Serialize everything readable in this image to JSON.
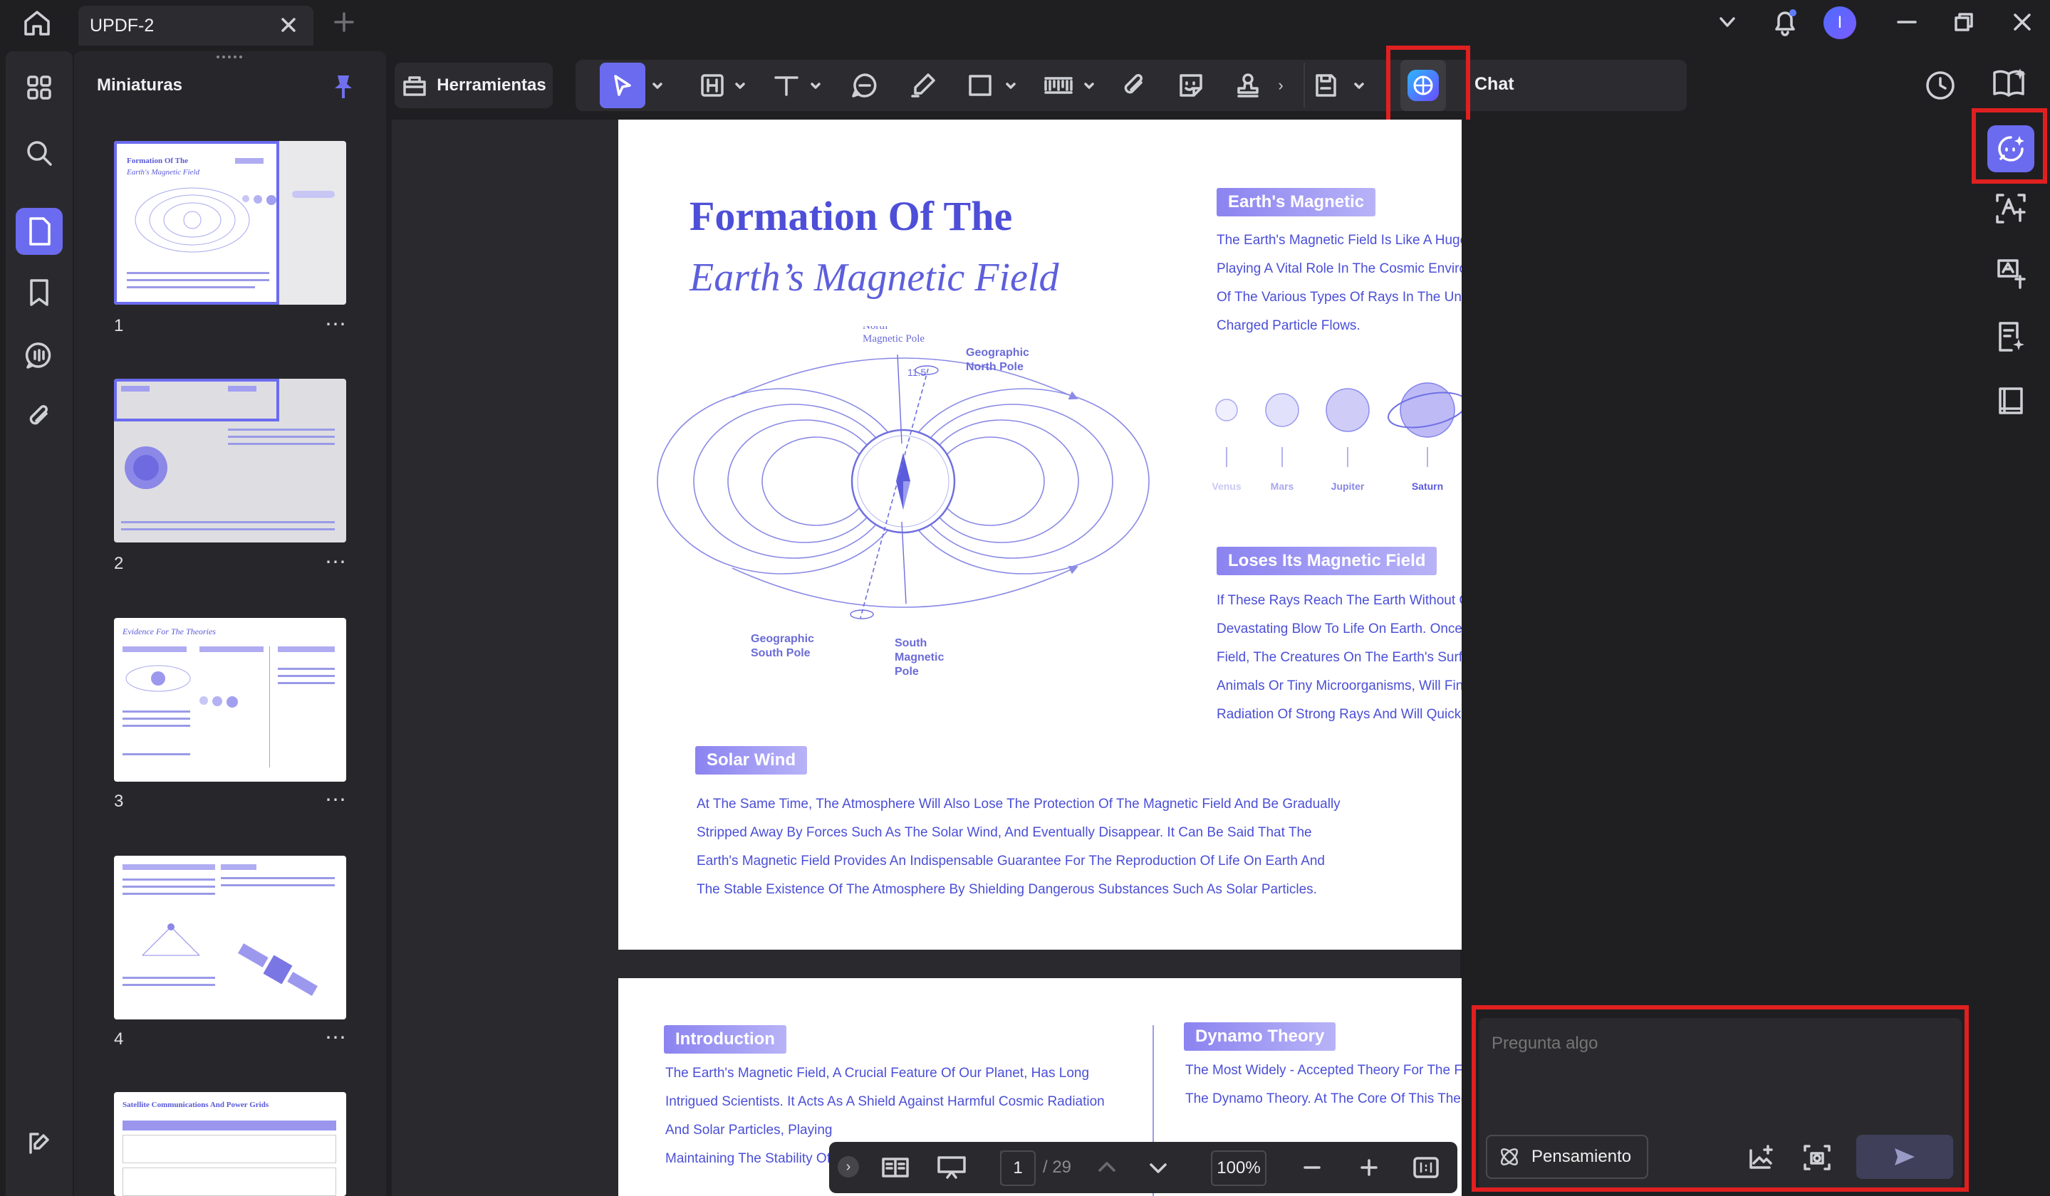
{
  "window": {
    "tab_title": "UPDF-2"
  },
  "thumbnails": {
    "title": "Miniaturas",
    "pages": [
      "1",
      "2",
      "3",
      "4"
    ],
    "more": "⋯",
    "thumb3_title": "Evidence For The Theories",
    "thumb5_title": "Satellite Communications And Power Grids"
  },
  "toolbar": {
    "tools_label": "Herramientas",
    "chat_label": "Chat"
  },
  "page1": {
    "title_line1": "Formation Of The",
    "title_line2": "Earth’s Magnetic Field",
    "diagram": {
      "north_magnetic": [
        "North",
        "Magnetic Pole"
      ],
      "geo_north": [
        "Geographic",
        "North Pole"
      ],
      "angle": "11.5",
      "geo_south": [
        "Geographic",
        "South Pole"
      ],
      "south_magnetic": [
        "South",
        "Magnetic",
        "Pole"
      ]
    },
    "section1": {
      "label": "Earth's Magnetic",
      "lines": [
        "The Earth's Magnetic Field Is Like A Huge",
        "Playing A Vital Role In The Cosmic Enviro",
        "Of The Various Types Of Rays In The Uni",
        "Charged Particle Flows."
      ]
    },
    "planets": [
      "Venus",
      "Mars",
      "Jupiter",
      "Saturn"
    ],
    "section2": {
      "label": "Loses Its Magnetic Field",
      "lines": [
        "If These Rays Reach The Earth Without G",
        "Devastating Blow To Life On Earth. Once",
        "Field, The Creatures On The Earth's Surfa",
        "Animals Or Tiny Microorganisms, Will Fin",
        "Radiation Of Strong Rays And Will Quickl"
      ]
    },
    "section3": {
      "label": "Solar Wind",
      "lines": [
        "At The Same Time, The Atmosphere Will Also Lose The Protection Of The Magnetic Field And Be Gradually",
        "Stripped Away By Forces Such As The Solar Wind, And Eventually Disappear. It Can Be Said That The",
        "Earth's Magnetic Field Provides An Indispensable Guarantee For The Reproduction Of Life On Earth And",
        "The Stable Existence Of The Atmosphere By Shielding Dangerous Substances Such As Solar Particles."
      ]
    }
  },
  "page2": {
    "intro_label": "Introduction",
    "intro_lines": [
      "The Earth's Magnetic Field, A Crucial Feature Of Our Planet, Has Long",
      "Intrigued Scientists. It Acts As A Shield Against Harmful Cosmic Radiation",
      "And Solar Particles, Playing",
      "Maintaining The Stability Of"
    ],
    "dynamo_label": "Dynamo Theory",
    "dynamo_lines": [
      "The Most Widely - Accepted Theory For The F",
      "The Dynamo Theory. At The Core Of This Theo"
    ]
  },
  "bottom_bar": {
    "page_current": "1",
    "page_total": "/ 29",
    "zoom": "100%"
  },
  "chat": {
    "placeholder": "Pregunta algo",
    "thinking_button": "Pensamiento"
  },
  "colors": {
    "accent": "#6b6bf0",
    "highlight": "#e02020",
    "page_text": "#4b4fd6"
  }
}
